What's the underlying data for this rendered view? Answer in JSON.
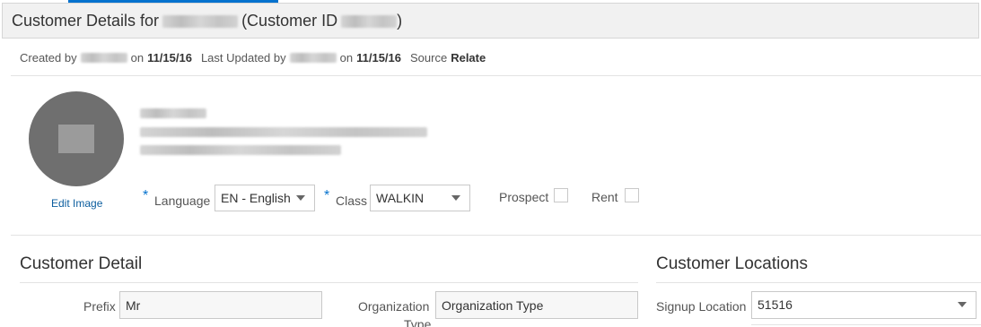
{
  "header": {
    "title_prefix": "Customer Details for",
    "title_mid": "(Customer ID",
    "title_suffix": ")"
  },
  "meta": {
    "created_by_label": "Created by",
    "on_label_1": "on",
    "created_date": "11/15/16",
    "updated_by_label": "Last Updated by",
    "on_label_2": "on",
    "updated_date": "11/15/16",
    "source_label": "Source",
    "source_value": "Relate"
  },
  "profile": {
    "edit_image_label": "Edit Image"
  },
  "form": {
    "language_label": "Language",
    "language_value": "EN - English",
    "class_label": "Class",
    "class_value": "WALKIN",
    "required_marker": "*",
    "prospect_label": "Prospect",
    "rent_label": "Rent"
  },
  "customer_detail": {
    "title": "Customer Detail",
    "prefix_label": "Prefix",
    "prefix_value": "Mr",
    "org_type_label_1": "Organization",
    "org_type_label_2": "Type",
    "org_type_value": "Organization Type"
  },
  "customer_locations": {
    "title": "Customer Locations",
    "signup_location_label": "Signup Location",
    "signup_location_value": "51516"
  }
}
